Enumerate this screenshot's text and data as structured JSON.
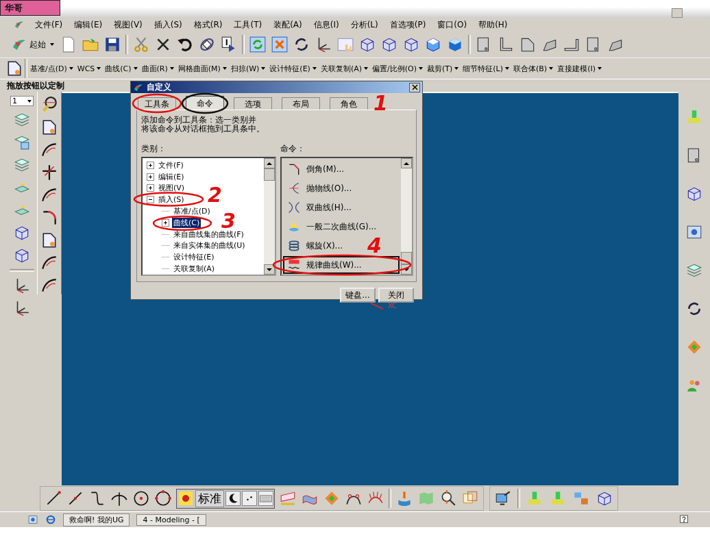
{
  "badge": {
    "text": "华哥"
  },
  "menu": [
    "文件(F)",
    "编辑(E)",
    "视图(V)",
    "插入(S)",
    "格式(R)",
    "工具(T)",
    "装配(A)",
    "信息(I)",
    "分析(L)",
    "首选项(P)",
    "窗口(O)",
    "帮助(H)"
  ],
  "start_button": {
    "label": "起始"
  },
  "feature_toolbar": [
    "基准/点(D)",
    "WCS",
    "曲线(C)",
    "曲面(R)",
    "网格曲面(M)",
    "扫掠(W)",
    "设计特征(E)",
    "关联复制(A)",
    "偏置/比例(O)",
    "裁剪(T)",
    "细节特征(L)",
    "联合体(B)",
    "直接建模(I)"
  ],
  "customize_hint": "拖放按钮以定制",
  "layer_select": {
    "value": "1"
  },
  "dialog": {
    "title": "自定义",
    "tabs": [
      {
        "label": "工具条",
        "selected": false
      },
      {
        "label": "命令",
        "selected": true
      },
      {
        "label": "选项",
        "selected": false
      },
      {
        "label": "布局",
        "selected": false
      },
      {
        "label": "角色",
        "selected": false
      }
    ],
    "description": [
      "添加命令到工具条：选一类别并",
      "将该命令从对话框拖到工具条中。"
    ],
    "category_label": "类别：",
    "command_label": "命令：",
    "categories": [
      {
        "label": "文件(F)",
        "kind": "group",
        "expanded": false,
        "selected": false
      },
      {
        "label": "编辑(E)",
        "kind": "group",
        "expanded": false,
        "selected": false
      },
      {
        "label": "视图(V)",
        "kind": "group",
        "expanded": false,
        "selected": false
      },
      {
        "label": "插入(S)",
        "kind": "group",
        "expanded": true,
        "selected": false,
        "children": [
          {
            "label": "基准/点(D)",
            "kind": "leaf",
            "selected": false
          },
          {
            "label": "曲线(C)",
            "kind": "group",
            "expanded": false,
            "selected": true
          },
          {
            "label": "来自曲线集的曲线(F)",
            "kind": "leaf",
            "selected": false
          },
          {
            "label": "来自实体集的曲线(U)",
            "kind": "leaf",
            "selected": false
          },
          {
            "label": "设计特征(E)",
            "kind": "leaf",
            "selected": false
          },
          {
            "label": "关联复制(A)",
            "kind": "leaf",
            "selected": false
          }
        ]
      }
    ],
    "commands": [
      {
        "label": "倒角(M)...",
        "selected": false
      },
      {
        "label": "抛物线(O)...",
        "selected": false
      },
      {
        "label": "双曲线(H)...",
        "selected": false
      },
      {
        "label": "一般二次曲线(G)...",
        "selected": false
      },
      {
        "label": "螺旋(X)...",
        "selected": false
      },
      {
        "label": "规律曲线(W)...",
        "selected": true
      }
    ],
    "buttons": [
      "键盘...",
      "关闭"
    ],
    "annotations": [
      "1",
      "2",
      "3",
      "4"
    ]
  },
  "axis_label": "XC",
  "ime_bar": {
    "mode": "标准"
  },
  "taskbar": [
    "救命啊! 我的UG",
    "4 - Modeling - ["
  ]
}
